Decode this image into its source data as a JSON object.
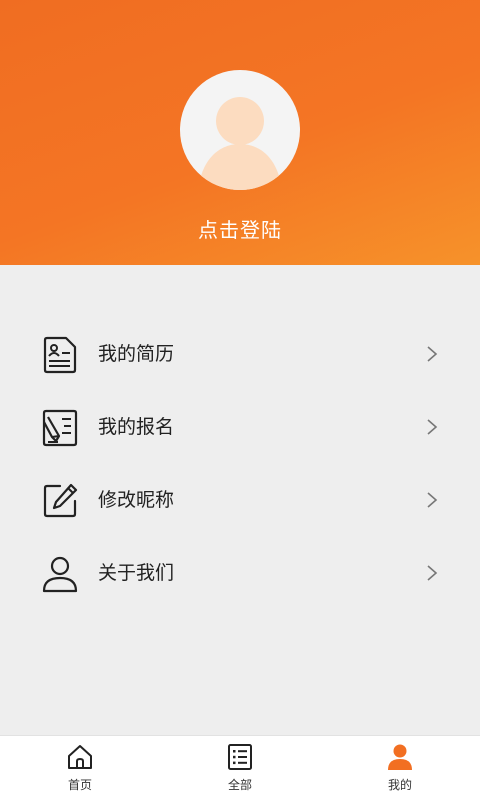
{
  "theme": {
    "accent": "#f26f22",
    "background": "#eeeeee",
    "text": "#222222"
  },
  "profile": {
    "avatar_icon": "default-user-avatar-icon",
    "login_label": "点击登陆"
  },
  "menu": {
    "items": [
      {
        "label": "我的简历",
        "icon": "resume-icon"
      },
      {
        "label": "我的报名",
        "icon": "signup-form-icon"
      },
      {
        "label": "修改昵称",
        "icon": "edit-icon"
      },
      {
        "label": "关于我们",
        "icon": "person-icon"
      }
    ],
    "arrow_icon": "chevron-right-icon"
  },
  "tabbar": {
    "tabs": [
      {
        "label": "首页",
        "icon": "home-icon",
        "active": false
      },
      {
        "label": "全部",
        "icon": "list-icon",
        "active": false
      },
      {
        "label": "我的",
        "icon": "user-icon",
        "active": true
      }
    ]
  }
}
